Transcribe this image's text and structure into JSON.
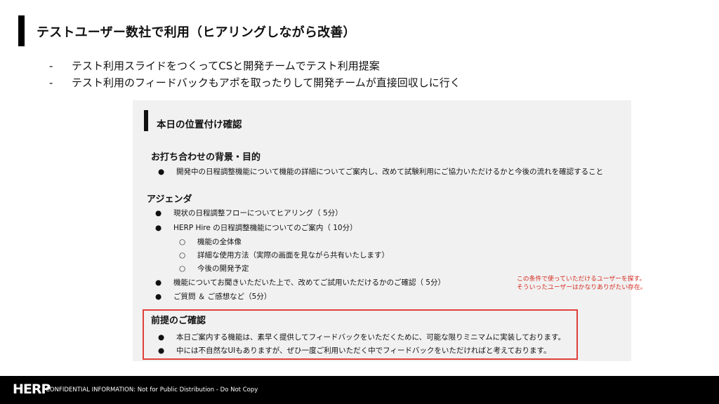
{
  "slide": {
    "title": "テストユーザー数社で利用（ヒアリングしながら改善）",
    "bullets": [
      {
        "marker": "-",
        "text": "テスト利用スライドをつくってCSと開発チームでテスト利用提案"
      },
      {
        "marker": "-",
        "text": "テスト利用のフィードバックもアポを取ったりして開発チームが直接回収しに行く"
      }
    ]
  },
  "panel": {
    "title": "本日の位置付け確認",
    "background": {
      "heading": "お打ち合わせの背景・目的",
      "items": [
        "開発中の日程調整機能について機能の詳細についてご案内し、改めて試験利用にご協力いただけるかと今後の流れを確認すること"
      ]
    },
    "agenda": {
      "heading": "アジェンダ",
      "item1": "現状の日程調整フローについてヒアリング（  5分）",
      "item2": "HERP Hire の日程調整機能についてのご案内（  10分）",
      "sub": [
        "機能の全体像",
        "詳細な使用方法（実際の画面を見ながら共有いたします）",
        "今後の開発予定"
      ],
      "item3": "機能についてお聞きいただいた上で、改めてご試用いただけるかのご確認（   5分）",
      "item4": "ご質問 ＆ ご感想など（5分）"
    },
    "premise": {
      "heading": "前提のご確認",
      "items": [
        "本日ご案内する機能は、素早く提供してフィードバックをいただくために、可能な限りミニマムに実装しております。",
        "中には不自然なUIもありますが、ぜひ一度ご利用いただく中でフィードバックをいただければと考えております。"
      ]
    },
    "bullet_glyph": "●",
    "sub_glyph": "○"
  },
  "annotation": {
    "line1": "この条件で使っていただけるユーザーを探す。",
    "line2": "そういったユーザーはかなりありがたい存在。",
    "color": "#d42a20"
  },
  "footer": {
    "logo": "HERP",
    "text": "CONFIDENTIAL INFORMATION: Not for Public Distribution - Do Not Copy"
  }
}
